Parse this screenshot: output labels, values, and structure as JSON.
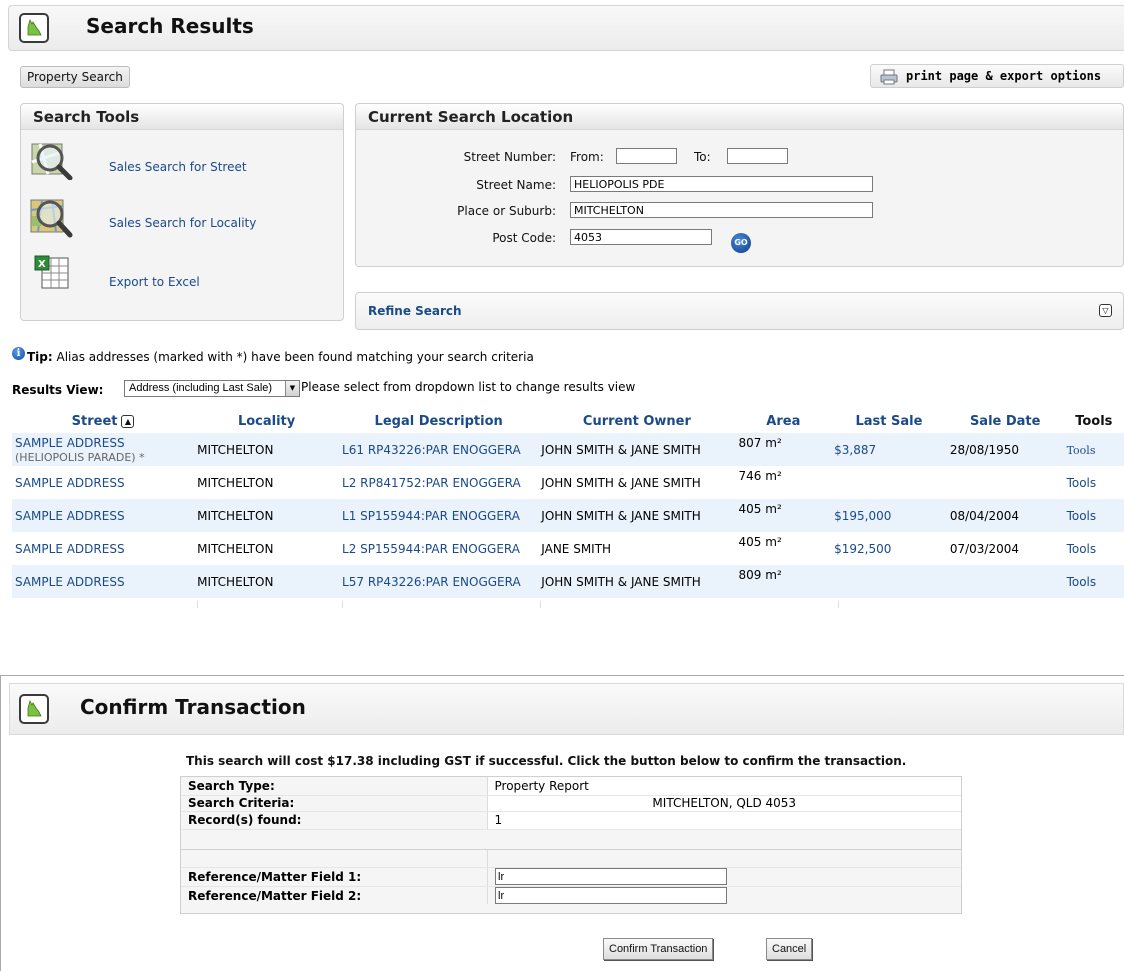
{
  "header": {
    "title": "Search Results"
  },
  "toolbar": {
    "property_search": "Property Search",
    "print_export": "print page & export options"
  },
  "search_tools": {
    "title": "Search Tools",
    "items": [
      {
        "label": "Sales Search for Street",
        "icon": "magnifier-street-icon"
      },
      {
        "label": "Sales Search for Locality",
        "icon": "magnifier-map-icon"
      },
      {
        "label": "Export to Excel",
        "icon": "excel-icon"
      }
    ]
  },
  "location": {
    "title": "Current Search Location",
    "street_number_label": "Street Number:",
    "from_label": "From:",
    "to_label": "To:",
    "from_value": "",
    "to_value": "",
    "street_name_label": "Street Name:",
    "street_name_value": "HELIOPOLIS PDE",
    "suburb_label": "Place or Suburb:",
    "suburb_value": "MITCHELTON",
    "postcode_label": "Post Code:",
    "postcode_value": "4053",
    "go_label": "GO"
  },
  "refine": {
    "label": "Refine Search"
  },
  "tip": {
    "prefix": "Tip:",
    "text": " Alias addresses (marked with *) have been found matching your search criteria"
  },
  "results_view": {
    "label": "Results View:",
    "selected": "Address (including Last Sale)",
    "hint": "Please select from dropdown list to change results view"
  },
  "table": {
    "headers": [
      "Street",
      "Locality",
      "Legal Description",
      "Current Owner",
      "Area",
      "Last Sale",
      "Sale Date",
      "Tools"
    ],
    "rows": [
      {
        "street": "SAMPLE ADDRESS",
        "alias": "(HELIOPOLIS PARADE) *",
        "locality": "MITCHELTON",
        "legal": "L61 RP43226:PAR ENOGGERA",
        "owner": "JOHN SMITH & JANE SMITH",
        "area": "807 m²",
        "last_sale": "$3,887",
        "sale_date": "28/08/1950",
        "tools": "Tools"
      },
      {
        "street": "SAMPLE ADDRESS",
        "alias": "",
        "locality": "MITCHELTON",
        "legal": "L2 RP841752:PAR ENOGGERA",
        "owner": "JOHN SMITH & JANE SMITH",
        "area": "746 m²",
        "last_sale": "",
        "sale_date": "",
        "tools": "Tools"
      },
      {
        "street": "SAMPLE ADDRESS",
        "alias": "",
        "locality": "MITCHELTON",
        "legal": "L1 SP155944:PAR ENOGGERA",
        "owner": "JOHN SMITH & JANE SMITH",
        "area": "405 m²",
        "last_sale": "$195,000",
        "sale_date": "08/04/2004",
        "tools": "Tools"
      },
      {
        "street": "SAMPLE ADDRESS",
        "alias": "",
        "locality": "MITCHELTON",
        "legal": "L2 SP155944:PAR ENOGGERA",
        "owner": "JANE SMITH",
        "area": "405 m²",
        "last_sale": "$192,500",
        "sale_date": "07/03/2004",
        "tools": "Tools"
      },
      {
        "street": "SAMPLE ADDRESS",
        "alias": "",
        "locality": "MITCHELTON",
        "legal": "L57 RP43226:PAR ENOGGERA",
        "owner": "JOHN SMITH & JANE SMITH",
        "area": "809 m²",
        "last_sale": "",
        "sale_date": "",
        "tools": "Tools"
      }
    ]
  },
  "confirm": {
    "title": "Confirm Transaction",
    "message": "This search will cost $17.38 including GST if successful. Click the button below to confirm the transaction.",
    "rows": [
      {
        "label": "Search Type:",
        "value": "Property Report"
      },
      {
        "label": "Search Criteria:",
        "value": "MITCHELTON, QLD 4053"
      },
      {
        "label": "Record(s) found:",
        "value": "1"
      }
    ],
    "ref1_label": "Reference/Matter Field 1:",
    "ref1_value": "lr",
    "ref2_label": "Reference/Matter Field 2:",
    "ref2_value": "lr",
    "confirm_button": "Confirm Transaction",
    "cancel_button": "Cancel"
  },
  "colors": {
    "link": "#1a4a8a",
    "row_alt": "#eaf2fb",
    "go_button": "#0b3c8a"
  }
}
